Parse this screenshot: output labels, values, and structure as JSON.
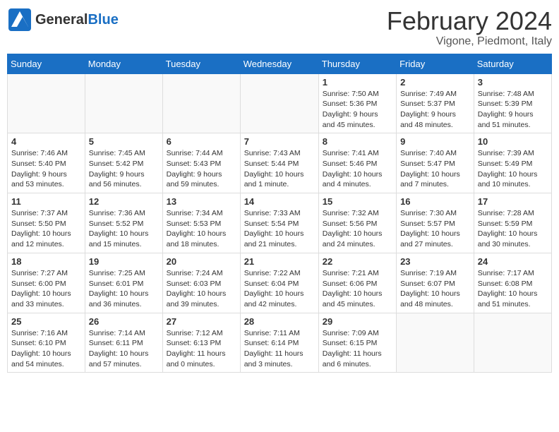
{
  "header": {
    "logo": {
      "general": "General",
      "blue": "Blue"
    },
    "title": "February 2024",
    "subtitle": "Vigone, Piedmont, Italy"
  },
  "weekdays": [
    "Sunday",
    "Monday",
    "Tuesday",
    "Wednesday",
    "Thursday",
    "Friday",
    "Saturday"
  ],
  "weeks": [
    [
      {
        "day": "",
        "info": ""
      },
      {
        "day": "",
        "info": ""
      },
      {
        "day": "",
        "info": ""
      },
      {
        "day": "",
        "info": ""
      },
      {
        "day": "1",
        "info": "Sunrise: 7:50 AM\nSunset: 5:36 PM\nDaylight: 9 hours\nand 45 minutes."
      },
      {
        "day": "2",
        "info": "Sunrise: 7:49 AM\nSunset: 5:37 PM\nDaylight: 9 hours\nand 48 minutes."
      },
      {
        "day": "3",
        "info": "Sunrise: 7:48 AM\nSunset: 5:39 PM\nDaylight: 9 hours\nand 51 minutes."
      }
    ],
    [
      {
        "day": "4",
        "info": "Sunrise: 7:46 AM\nSunset: 5:40 PM\nDaylight: 9 hours\nand 53 minutes."
      },
      {
        "day": "5",
        "info": "Sunrise: 7:45 AM\nSunset: 5:42 PM\nDaylight: 9 hours\nand 56 minutes."
      },
      {
        "day": "6",
        "info": "Sunrise: 7:44 AM\nSunset: 5:43 PM\nDaylight: 9 hours\nand 59 minutes."
      },
      {
        "day": "7",
        "info": "Sunrise: 7:43 AM\nSunset: 5:44 PM\nDaylight: 10 hours\nand 1 minute."
      },
      {
        "day": "8",
        "info": "Sunrise: 7:41 AM\nSunset: 5:46 PM\nDaylight: 10 hours\nand 4 minutes."
      },
      {
        "day": "9",
        "info": "Sunrise: 7:40 AM\nSunset: 5:47 PM\nDaylight: 10 hours\nand 7 minutes."
      },
      {
        "day": "10",
        "info": "Sunrise: 7:39 AM\nSunset: 5:49 PM\nDaylight: 10 hours\nand 10 minutes."
      }
    ],
    [
      {
        "day": "11",
        "info": "Sunrise: 7:37 AM\nSunset: 5:50 PM\nDaylight: 10 hours\nand 12 minutes."
      },
      {
        "day": "12",
        "info": "Sunrise: 7:36 AM\nSunset: 5:52 PM\nDaylight: 10 hours\nand 15 minutes."
      },
      {
        "day": "13",
        "info": "Sunrise: 7:34 AM\nSunset: 5:53 PM\nDaylight: 10 hours\nand 18 minutes."
      },
      {
        "day": "14",
        "info": "Sunrise: 7:33 AM\nSunset: 5:54 PM\nDaylight: 10 hours\nand 21 minutes."
      },
      {
        "day": "15",
        "info": "Sunrise: 7:32 AM\nSunset: 5:56 PM\nDaylight: 10 hours\nand 24 minutes."
      },
      {
        "day": "16",
        "info": "Sunrise: 7:30 AM\nSunset: 5:57 PM\nDaylight: 10 hours\nand 27 minutes."
      },
      {
        "day": "17",
        "info": "Sunrise: 7:28 AM\nSunset: 5:59 PM\nDaylight: 10 hours\nand 30 minutes."
      }
    ],
    [
      {
        "day": "18",
        "info": "Sunrise: 7:27 AM\nSunset: 6:00 PM\nDaylight: 10 hours\nand 33 minutes."
      },
      {
        "day": "19",
        "info": "Sunrise: 7:25 AM\nSunset: 6:01 PM\nDaylight: 10 hours\nand 36 minutes."
      },
      {
        "day": "20",
        "info": "Sunrise: 7:24 AM\nSunset: 6:03 PM\nDaylight: 10 hours\nand 39 minutes."
      },
      {
        "day": "21",
        "info": "Sunrise: 7:22 AM\nSunset: 6:04 PM\nDaylight: 10 hours\nand 42 minutes."
      },
      {
        "day": "22",
        "info": "Sunrise: 7:21 AM\nSunset: 6:06 PM\nDaylight: 10 hours\nand 45 minutes."
      },
      {
        "day": "23",
        "info": "Sunrise: 7:19 AM\nSunset: 6:07 PM\nDaylight: 10 hours\nand 48 minutes."
      },
      {
        "day": "24",
        "info": "Sunrise: 7:17 AM\nSunset: 6:08 PM\nDaylight: 10 hours\nand 51 minutes."
      }
    ],
    [
      {
        "day": "25",
        "info": "Sunrise: 7:16 AM\nSunset: 6:10 PM\nDaylight: 10 hours\nand 54 minutes."
      },
      {
        "day": "26",
        "info": "Sunrise: 7:14 AM\nSunset: 6:11 PM\nDaylight: 10 hours\nand 57 minutes."
      },
      {
        "day": "27",
        "info": "Sunrise: 7:12 AM\nSunset: 6:13 PM\nDaylight: 11 hours\nand 0 minutes."
      },
      {
        "day": "28",
        "info": "Sunrise: 7:11 AM\nSunset: 6:14 PM\nDaylight: 11 hours\nand 3 minutes."
      },
      {
        "day": "29",
        "info": "Sunrise: 7:09 AM\nSunset: 6:15 PM\nDaylight: 11 hours\nand 6 minutes."
      },
      {
        "day": "",
        "info": ""
      },
      {
        "day": "",
        "info": ""
      }
    ]
  ]
}
